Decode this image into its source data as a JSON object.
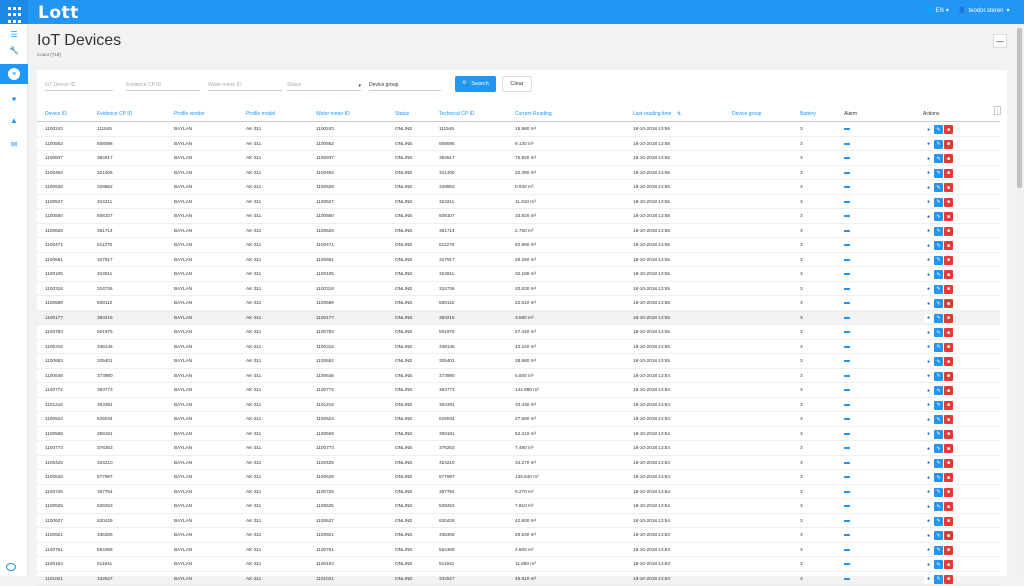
{
  "header": {
    "logo": "Lott",
    "lang": "EN",
    "user": "teodor.steren"
  },
  "sidebar": {
    "items": [
      {
        "icon": "menu-icon"
      },
      {
        "icon": "wrench-icon"
      },
      {
        "icon": "list-icon"
      },
      {
        "icon": "info-icon"
      },
      {
        "icon": "car-icon"
      },
      {
        "icon": "mail-icon"
      }
    ]
  },
  "page": {
    "title": "IoT Devices",
    "count": "Count (718)",
    "collapse": "—"
  },
  "filters": {
    "iot_device_id": "IoT Device ID",
    "evidence_cp_id": "Evidence CP ID",
    "water_meter_id": "Water meter ID",
    "status": "Status",
    "device_group": "Device group",
    "search_label": "Search",
    "clear_label": "Clear"
  },
  "table": {
    "columns": [
      "Device ID",
      "Evidence CP ID",
      "Profile vendor",
      "Profile model",
      "Water meter ID",
      "Status",
      "Technical CP ID",
      "Current Reading",
      "Last reading time",
      "Device group",
      "Battery",
      "Alarm",
      "Actions"
    ],
    "rows": [
      [
        "1100243",
        "111545",
        "BAYLAN",
        "AK-311",
        "1100243",
        "ONLINE",
        "111545",
        "15.980 m³",
        "18-10-2018 13:56",
        "",
        "3"
      ],
      [
        "1100562",
        "508096",
        "BAYLAN",
        "AK-311",
        "1100562",
        "ONLINE",
        "508096",
        "9.130 m³",
        "18-10-2018 13:56",
        "",
        "3"
      ],
      [
        "1100837",
        "384617",
        "BAYLAN",
        "AK-311",
        "1100837",
        "ONLINE",
        "384617",
        "75.920 m³",
        "18-10-2018 13:56",
        "",
        "3"
      ],
      [
        "1100464",
        "321406",
        "BAYLAN",
        "AK-311",
        "1100464",
        "ONLINE",
        "321406",
        "22.390 m³",
        "18-10-2018 13:56",
        "",
        "3"
      ],
      [
        "1100528",
        "328862",
        "BAYLAN",
        "AK-311",
        "1100528",
        "ONLINE",
        "328862",
        "0.930 m³",
        "18-10-2018 13:56",
        "",
        "3"
      ],
      [
        "1100527",
        "324211",
        "BAYLAN",
        "AK-311",
        "1100527",
        "ONLINE",
        "324211",
        "11.910 m³",
        "18-10-2018 13:56",
        "",
        "3"
      ],
      [
        "1100560",
        "508107",
        "BAYLAN",
        "AK-311",
        "1100560",
        "ONLINE",
        "508107",
        "33.820 m³",
        "18-10-2018 13:56",
        "",
        "3"
      ],
      [
        "1100626",
        "351714",
        "BAYLAN",
        "AK-311",
        "1100626",
        "ONLINE",
        "351714",
        "2.750 m³",
        "18-10-2018 13:55",
        "",
        "3"
      ],
      [
        "1100471",
        "611270",
        "BAYLAN",
        "AK-311",
        "1100471",
        "ONLINE",
        "611270",
        "62.890 m³",
        "18-10-2018 13:55",
        "",
        "3"
      ],
      [
        "1100651",
        "327917",
        "BAYLAN",
        "AK-311",
        "1100651",
        "ONLINE",
        "327917",
        "28.260 m³",
        "18-10-2018 13:55",
        "",
        "3"
      ],
      [
        "1100105",
        "324911",
        "BAYLAN",
        "AK-311",
        "1100105",
        "ONLINE",
        "324911",
        "32.180 m³",
        "18-10-2018 13:55",
        "",
        "3"
      ],
      [
        "1100318",
        "324736",
        "BAYLAN",
        "AK-311",
        "1100318",
        "ONLINE",
        "324736",
        "20.830 m³",
        "18-10-2018 13:55",
        "",
        "3"
      ],
      [
        "1100589",
        "508110",
        "BAYLAN",
        "AK-311",
        "1100589",
        "ONLINE",
        "508110",
        "22.610 m³",
        "18-10-2018 13:55",
        "",
        "3"
      ],
      [
        "1100177",
        "383215",
        "BAYLAN",
        "AK-311",
        "1100177",
        "ONLINE",
        "383215",
        "3.880 m³",
        "18-10-2018 13:55",
        "",
        "3"
      ],
      [
        "1100783",
        "501975",
        "BAYLAN",
        "AK-311",
        "1100783",
        "ONLINE",
        "501975",
        "27.440 m³",
        "18-10-2018 13:55",
        "",
        "3"
      ],
      [
        "1100315",
        "338146",
        "BAYLAN",
        "AK-311",
        "1100315",
        "ONLINE",
        "338146",
        "43.240 m³",
        "18-10-2018 13:55",
        "",
        "3"
      ],
      [
        "1100652",
        "325401",
        "BAYLAN",
        "AK-311",
        "1100652",
        "ONLINE",
        "325401",
        "28.680 m³",
        "18-10-2018 13:55",
        "",
        "3"
      ],
      [
        "1100648",
        "373980",
        "BAYLAN",
        "AK-311",
        "1100648",
        "ONLINE",
        "373980",
        "5.500 m³",
        "18-10-2018 13:54",
        "",
        "3"
      ],
      [
        "1100772",
        "353773",
        "BAYLAN",
        "AK-311",
        "1100772",
        "ONLINE",
        "353773",
        "142.890 m³",
        "18-10-2018 13:54",
        "",
        "3"
      ],
      [
        "1101216",
        "363391",
        "BAYLAN",
        "AK-311",
        "1101216",
        "ONLINE",
        "363391",
        "33.430 m³",
        "18-10-2018 13:54",
        "",
        "3"
      ],
      [
        "1100524",
        "625034",
        "BAYLAN",
        "AK-311",
        "1100524",
        "ONLINE",
        "625034",
        "27.690 m³",
        "18-10-2018 13:54",
        "",
        "3"
      ],
      [
        "1100568",
        "359191",
        "BAYLAN",
        "AK-311",
        "1100568",
        "ONLINE",
        "359191",
        "52.210 m³",
        "18-10-2018 13:54",
        "",
        "3"
      ],
      [
        "1100773",
        "376263",
        "BAYLAN",
        "AK-311",
        "1100773",
        "ONLINE",
        "376263",
        "7.490 m³",
        "18-10-2018 13:54",
        "",
        "3"
      ],
      [
        "1100425",
        "324210",
        "BAYLAN",
        "AK-311",
        "1100425",
        "ONLINE",
        "324210",
        "34.270 m³",
        "18-10-2018 13:54",
        "",
        "3"
      ],
      [
        "1100628",
        "577997",
        "BAYLAN",
        "AK-311",
        "1100628",
        "ONLINE",
        "577997",
        "135.840 m³",
        "18-10-2018 13:54",
        "",
        "3"
      ],
      [
        "1100726",
        "357754",
        "BAYLAN",
        "AK-311",
        "1100726",
        "ONLINE",
        "357754",
        "9.270 m³",
        "18-10-2018 13:54",
        "",
        "3"
      ],
      [
        "1100625",
        "529253",
        "BAYLAN",
        "AK-311",
        "1100625",
        "ONLINE",
        "529253",
        "7.810 m³",
        "18-10-2018 13:54",
        "",
        "3"
      ],
      [
        "1100627",
        "620429",
        "BAYLAN",
        "AK-311",
        "1100627",
        "ONLINE",
        "620429",
        "42.800 m³",
        "18-10-2018 13:54",
        "",
        "3"
      ],
      [
        "1100921",
        "336306",
        "BAYLAN",
        "AK-311",
        "1100921",
        "ONLINE",
        "336306",
        "28.630 m³",
        "18-10-2018 13:53",
        "",
        "3"
      ],
      [
        "1100761",
        "554368",
        "BAYLAN",
        "AK-311",
        "1100761",
        "ONLINE",
        "554368",
        "4.800 m³",
        "18-10-2018 13:53",
        "",
        "3"
      ],
      [
        "1100153",
        "511941",
        "BAYLAN",
        "AK-311",
        "1100153",
        "ONLINE",
        "511941",
        "11.850 m³",
        "18-10-2018 13:53",
        "",
        "3"
      ],
      [
        "1101021",
        "332527",
        "BAYLAN",
        "AK-311",
        "1101021",
        "ONLINE",
        "332527",
        "45.910 m³",
        "18-10-2018 13:53",
        "",
        "3"
      ]
    ]
  },
  "colors": {
    "primary": "#2196f3",
    "danger": "#e53935"
  }
}
